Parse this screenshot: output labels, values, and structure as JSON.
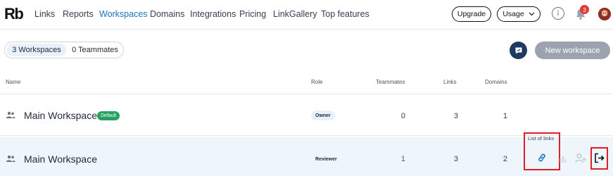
{
  "brand": {
    "logo": "Rb"
  },
  "nav": {
    "links": [
      "Links",
      "Reports",
      "Workspaces",
      "Domains",
      "Integrations",
      "Pricing",
      "LinkGallery",
      "Top features"
    ],
    "active": "Workspaces",
    "upgrade_label": "Upgrade",
    "usage_label": "Usage",
    "notification_count": "3",
    "info_icon": "info-icon"
  },
  "toolbar": {
    "tabs": [
      {
        "label": "3 Workspaces",
        "active": true
      },
      {
        "label": "0 Teammates",
        "active": false
      }
    ],
    "new_workspace_label": "New workspace"
  },
  "table": {
    "headers": {
      "name": "Name",
      "role": "Role",
      "teammates": "Teammates",
      "links": "Links",
      "domains": "Domains"
    },
    "rows": [
      {
        "name": "Main Workspace",
        "badge": "Default",
        "role": "Owner",
        "teammates": "0",
        "links": "3",
        "domains": "1"
      },
      {
        "name": "Main Workspace",
        "badge": "",
        "role": "Reviewer",
        "teammates": "1",
        "links": "3",
        "domains": "2"
      }
    ],
    "tooltip": "List of links"
  },
  "colors": {
    "accent": "#1a73b8",
    "default_badge": "#27a060",
    "highlight": "#e11d2a",
    "notification": "#e53935"
  }
}
